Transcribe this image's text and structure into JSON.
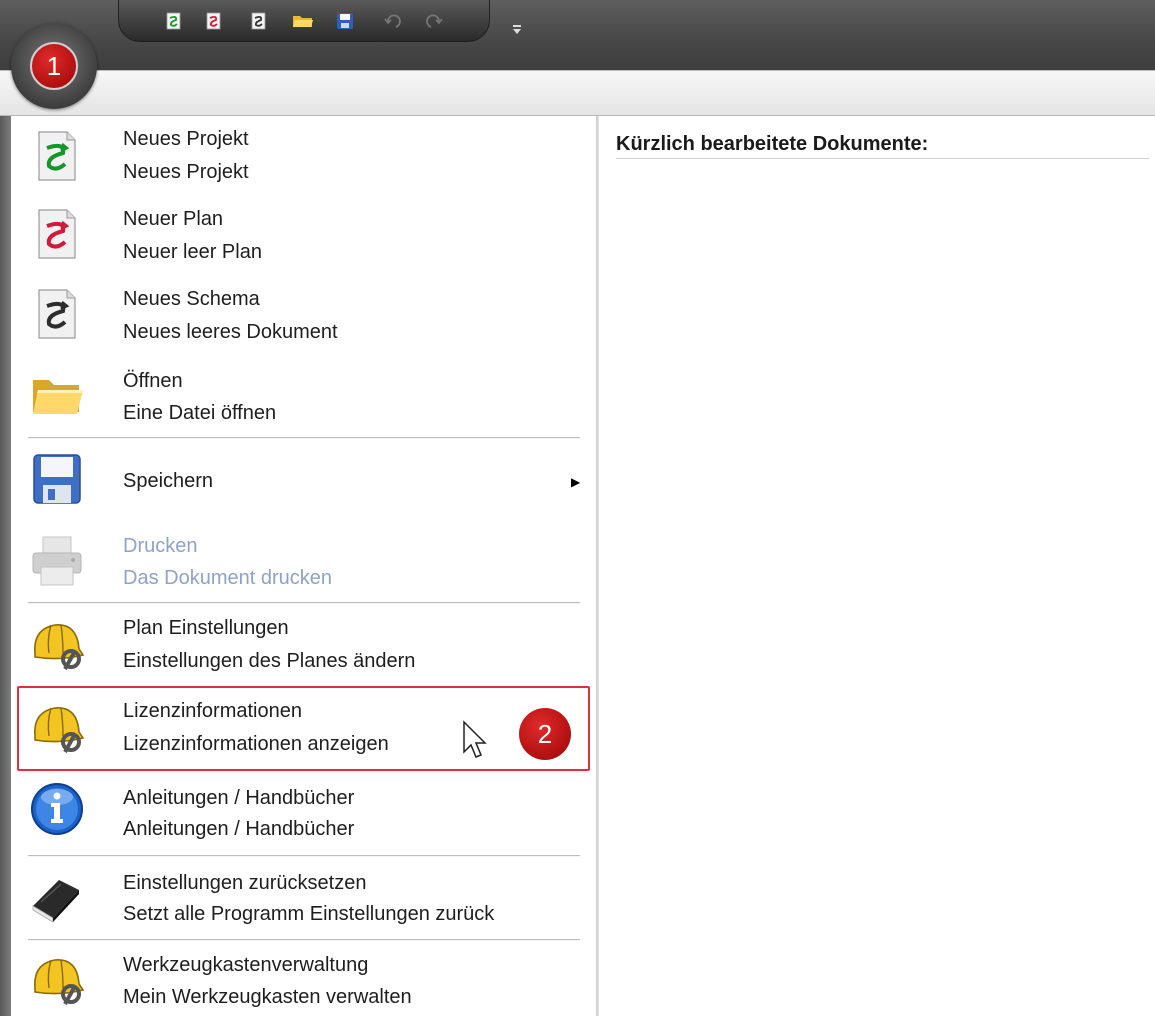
{
  "quick_access_toolbar": {
    "icons": [
      "new-project-icon",
      "new-plan-icon",
      "new-schema-icon",
      "open-folder-icon",
      "save-icon",
      "undo-icon",
      "redo-icon"
    ],
    "customize_icon": "customize-toolbar-icon"
  },
  "badges": {
    "step1": "1",
    "step2": "2"
  },
  "menu": {
    "items": [
      {
        "title": "Neues Projekt",
        "description": "Neues Projekt",
        "icon": "green-document-icon"
      },
      {
        "title": "Neuer Plan",
        "description": "Neuer leer Plan",
        "icon": "red-document-icon"
      },
      {
        "title": "Neues Schema",
        "description": "Neues leeres Dokument",
        "icon": "gray-document-icon"
      },
      {
        "title": "Öffnen",
        "description": "Eine Datei öffnen",
        "icon": "folder-icon"
      },
      {
        "title": "Speichern",
        "description": "",
        "icon": "floppy-disk-icon",
        "has_submenu": true
      },
      {
        "title": "Drucken",
        "description": "Das Dokument drucken",
        "icon": "printer-icon",
        "disabled": true
      },
      {
        "title": "Plan Einstellungen",
        "description": "Einstellungen des Planes ändern",
        "icon": "hardhat-wrench-icon"
      },
      {
        "title": "Lizenzinformationen",
        "description": "Lizenzinformationen anzeigen",
        "icon": "hardhat-wrench-icon",
        "highlighted": true
      },
      {
        "title": "Anleitungen / Handbücher",
        "description": "Anleitungen / Handbücher",
        "icon": "info-icon"
      },
      {
        "title": "Einstellungen zurücksetzen",
        "description": "Setzt alle Programm Einstellungen zurück",
        "icon": "eraser-icon"
      },
      {
        "title": "Werkzeugkastenverwaltung",
        "description": "Mein Werkzeugkasten verwalten",
        "icon": "hardhat-wrench-icon"
      }
    ]
  },
  "recent": {
    "title": "Kürzlich bearbeitete Dokumente:"
  },
  "colors": {
    "highlight_border": "#e0303a",
    "badge_red": "#c81818",
    "disabled_text": "#8fa2c8"
  }
}
